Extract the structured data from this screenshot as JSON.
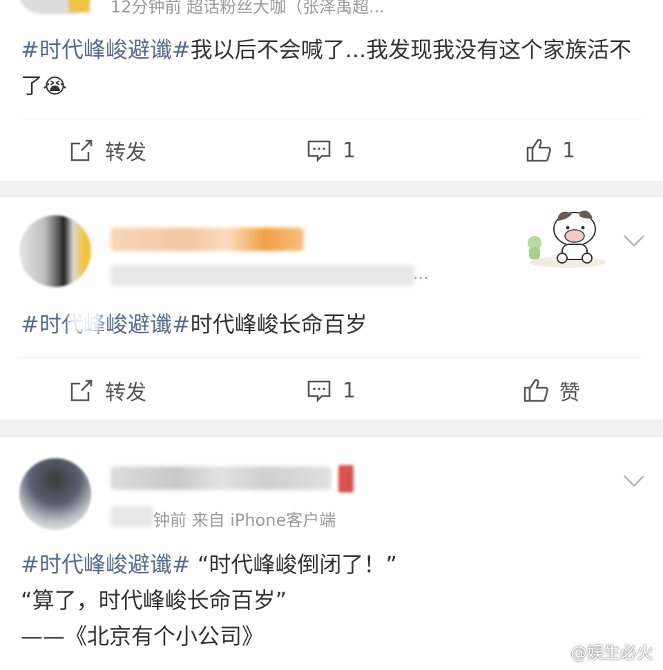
{
  "post1": {
    "meta": "12分钟前  超话粉丝大咖（张泽禹超...",
    "topic": "#时代峰峻避谶#",
    "text": "我以后不会喊了...我发现我没有这个家族活不了",
    "emoji_icon": "crying-face-icon",
    "actions": {
      "repost": "转发",
      "comment": "1",
      "like": "1"
    }
  },
  "post2": {
    "meta_tail": "...",
    "topic": "#时代峰峻避谶#",
    "text": "时代峰峻长命百岁",
    "actions": {
      "repost": "转发",
      "comment": "1",
      "like": "赞"
    }
  },
  "post3": {
    "meta": "钟前  来自 iPhone客户端",
    "topic": "#时代峰峻避谶#",
    "line1_text": "“时代峰峻倒闭了！”",
    "line2": "“算了，时代峰峻长命百岁”",
    "line3": "——《北京有个小公司》"
  },
  "watermark": "@娱生必火",
  "colors": {
    "topic": "#546b91",
    "meta": "#9a9a9a",
    "separator": "#f0f0f0"
  }
}
